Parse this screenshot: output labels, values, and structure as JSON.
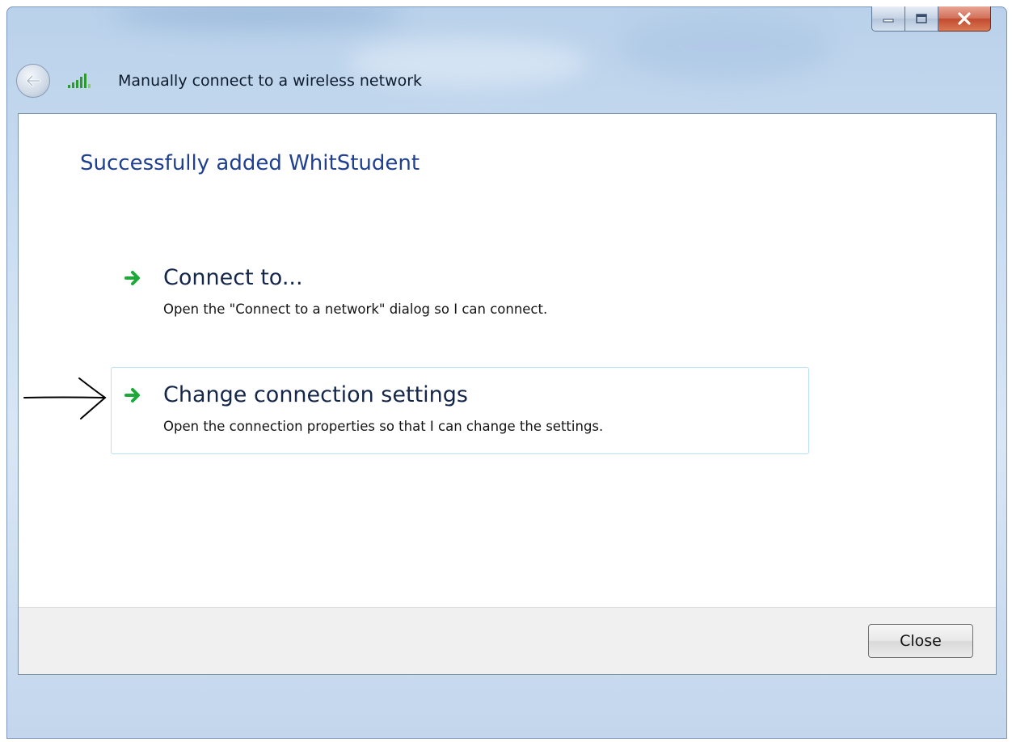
{
  "window": {
    "nav_title": "Manually connect to a wireless network"
  },
  "content": {
    "headline": "Successfully added WhitStudent",
    "options": [
      {
        "title": "Connect to...",
        "description": "Open the \"Connect to a network\" dialog so I can connect."
      },
      {
        "title": "Change connection settings",
        "description": "Open the connection properties so that I can change the settings."
      }
    ]
  },
  "footer": {
    "close_label": "Close"
  },
  "icons": {
    "back": "back-arrow-icon",
    "signal": "wireless-signal-icon",
    "option_arrow": "green-arrow-icon",
    "minimize": "minimize-icon",
    "maximize": "maximize-icon",
    "close": "close-x-icon"
  },
  "colors": {
    "headline": "#1f3f8f",
    "option_hover_border": "#b9dff2",
    "arrow_green": "#1fa83a",
    "close_red": "#c24b2f"
  }
}
